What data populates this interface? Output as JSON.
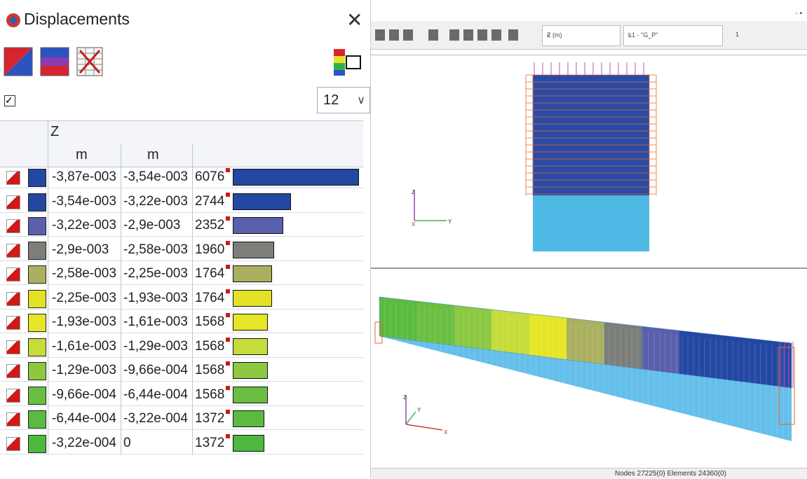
{
  "dialog": {
    "title": "Displacements",
    "close_symbol": "✕",
    "checkbox_mark": "✓",
    "levels_value": "12",
    "chevron": "∨"
  },
  "table": {
    "component": "Z",
    "unit_from": "m",
    "unit_to": "m",
    "rows": [
      {
        "from": "-3,87e-003",
        "to": "-3,54e-003",
        "count": "6076",
        "color": "#2447a2",
        "fill": 1.0
      },
      {
        "from": "-3,54e-003",
        "to": "-3,22e-003",
        "count": "2744",
        "color": "#2447a2",
        "fill": 0.46
      },
      {
        "from": "-3,22e-003",
        "to": "-2,9e-003",
        "count": "2352",
        "color": "#5a5fad",
        "fill": 0.4
      },
      {
        "from": "-2,9e-003",
        "to": "-2,58e-003",
        "count": "1960",
        "color": "#7c7f79",
        "fill": 0.33
      },
      {
        "from": "-2,58e-003",
        "to": "-2,25e-003",
        "count": "1764",
        "color": "#aab060",
        "fill": 0.31
      },
      {
        "from": "-2,25e-003",
        "to": "-1,93e-003",
        "count": "1764",
        "color": "#e3e026",
        "fill": 0.31
      },
      {
        "from": "-1,93e-003",
        "to": "-1,61e-003",
        "count": "1568",
        "color": "#e5e626",
        "fill": 0.28
      },
      {
        "from": "-1,61e-003",
        "to": "-1,29e-003",
        "count": "1568",
        "color": "#c5dc3a",
        "fill": 0.28
      },
      {
        "from": "-1,29e-003",
        "to": "-9,66e-004",
        "count": "1568",
        "color": "#8cc840",
        "fill": 0.28
      },
      {
        "from": "-9,66e-004",
        "to": "-6,44e-004",
        "count": "1568",
        "color": "#6abf42",
        "fill": 0.28
      },
      {
        "from": "-6,44e-004",
        "to": "-3,22e-004",
        "count": "1372",
        "color": "#5bbb40",
        "fill": 0.25
      },
      {
        "from": "-3,22e-004",
        "to": "0",
        "count": "1372",
        "color": "#4fb83f",
        "fill": 0.25
      }
    ]
  },
  "viewer": {
    "dropdown1": "Z (m)",
    "dropdown2": "L1 - \"G_P\"",
    "dropdown3": "1",
    "window_buttons": "- •",
    "status": "Nodes 27225(0) Elements 24360(0)",
    "axes_labels": {
      "z": "Z",
      "x": "X",
      "y": "Y"
    }
  }
}
